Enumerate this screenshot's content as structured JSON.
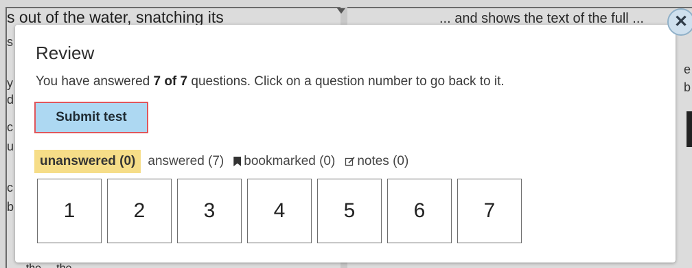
{
  "background": {
    "top_text": "s out of the water, snatching its",
    "right_text": "... and shows the text of the full ...",
    "bottom_text": "... the ... the ...",
    "left_fragments": [
      "s",
      "y",
      "d",
      "c",
      "u",
      "c",
      "b"
    ],
    "right_fragments": [
      "e",
      "b"
    ]
  },
  "modal": {
    "title": "Review",
    "info_prefix": "You have answered ",
    "info_bold": "7 of 7",
    "info_suffix": " questions. Click on a question number to go back to it.",
    "submit_label": "Submit test",
    "close_glyph": "✕",
    "filters": [
      {
        "label": "unanswered (0)",
        "active": true
      },
      {
        "label": "answered (7)",
        "active": false
      },
      {
        "label": "bookmarked (0)",
        "active": false,
        "icon": "bookmark-icon"
      },
      {
        "label": "notes (0)",
        "active": false,
        "icon": "notes-icon"
      }
    ],
    "questions": [
      "1",
      "2",
      "3",
      "4",
      "5",
      "6",
      "7"
    ]
  }
}
